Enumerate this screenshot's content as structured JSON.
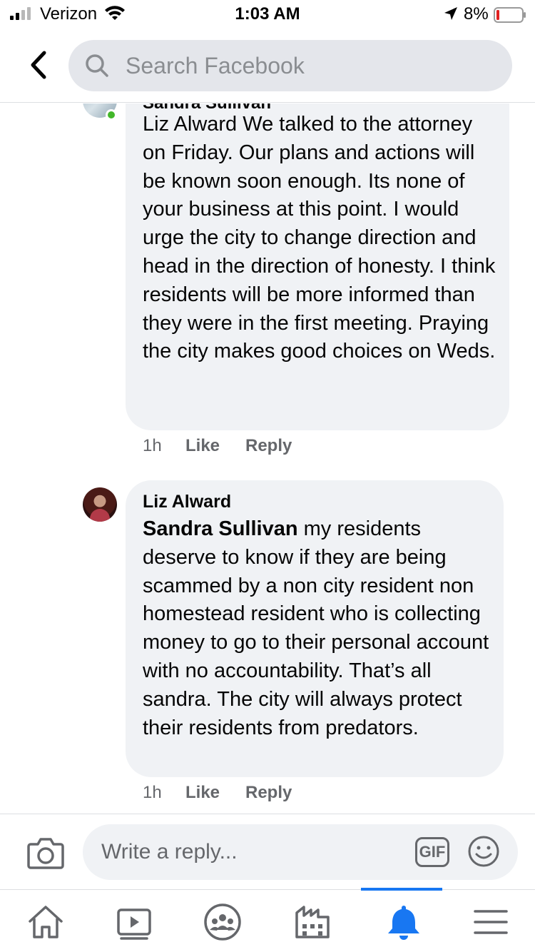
{
  "status_bar": {
    "carrier": "Verizon",
    "time": "1:03 AM",
    "battery_percent": "8%"
  },
  "header": {
    "search_placeholder": "Search Facebook"
  },
  "comments": [
    {
      "author": "Sandra Sullivan",
      "online": true,
      "text": "Liz Alward We talked to the attorney on Friday. Our plans and actions will be known soon enough. Its none of your business at this point.  I would urge the city to change direction and head in the direction of honesty. I think residents will be more informed than they were in the first meeting. Praying the city makes good choices on Weds.",
      "time": "1h",
      "like_label": "Like",
      "reply_label": "Reply"
    },
    {
      "author": "Liz Alward",
      "mention": "Sandra Sullivan",
      "text": " my residents deserve to know if they are being scammed by a non city resident non homestead resident who is collecting money to go to their personal account with no accountability.  That’s all sandra. The city will always protect their residents from predators.",
      "time": "1h",
      "like_label": "Like",
      "reply_label": "Reply"
    }
  ],
  "composer": {
    "placeholder": "Write a reply...",
    "gif_label": "GIF"
  },
  "tabbar": {
    "active_tab": "notifications",
    "tabs": [
      "home",
      "watch",
      "groups",
      "marketplace",
      "notifications",
      "menu"
    ]
  },
  "colors": {
    "accent": "#1877f2",
    "bubble": "#f0f2f5",
    "secondary_text": "#65676b",
    "online": "#42b72a"
  }
}
